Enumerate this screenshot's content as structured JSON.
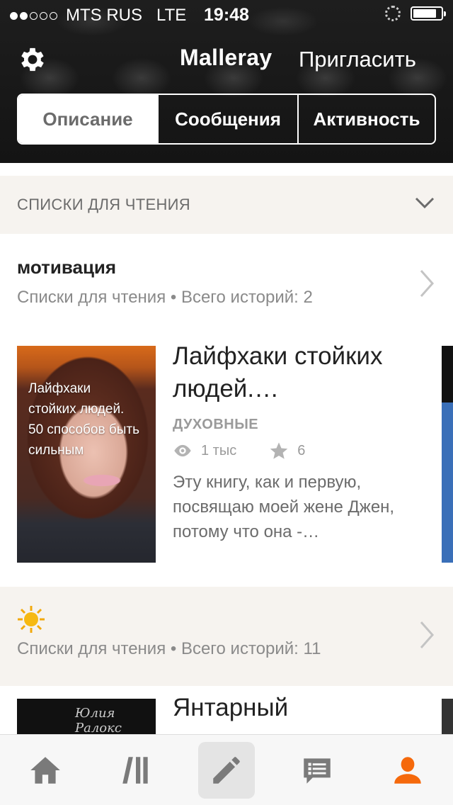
{
  "status_bar": {
    "carrier": "MTS RUS",
    "network": "LTE",
    "time": "19:48",
    "signal_bars_filled": 2,
    "signal_bars_total": 5
  },
  "header": {
    "settings_icon": "gear-icon",
    "profile_name": "Malleray",
    "invite_label": "Пригласить",
    "tabs": [
      {
        "label": "Описание",
        "selected": true
      },
      {
        "label": "Сообщения",
        "selected": false
      },
      {
        "label": "Активность",
        "selected": false
      }
    ]
  },
  "reading_lists": {
    "section_label": "СПИСКИ ДЛЯ ЧТЕНИЯ",
    "lists": [
      {
        "title": "мотивация",
        "subtitle": "Списки для чтения • Всего историй: 2",
        "story": {
          "cover_text": "Лайфхаки стойких людей. 50 способов быть сильным",
          "title": "Лайфхаки стойких людей.…",
          "genre": "ДУХОВНЫЕ",
          "reads": "1 тыс",
          "votes": "6",
          "description": "Эту книгу, как и первую, посвящаю моей жене Джен, потому что она -…"
        }
      },
      {
        "title_icon": "sun-icon",
        "subtitle": "Списки для чтения • Всего историй: 11",
        "story": {
          "cover_text": "Юлия Ралокс",
          "title": "Янтарный"
        }
      }
    ]
  },
  "tabbar": {
    "items": [
      {
        "icon": "home-icon"
      },
      {
        "icon": "library-icon"
      },
      {
        "icon": "pencil-icon",
        "highlighted": true
      },
      {
        "icon": "messages-icon"
      },
      {
        "icon": "profile-icon",
        "active": true,
        "color": "#f5690c"
      }
    ]
  },
  "colors": {
    "accent": "#f5690c",
    "section_bg": "#f6f3ef",
    "muted_text": "#8a8a8a"
  }
}
